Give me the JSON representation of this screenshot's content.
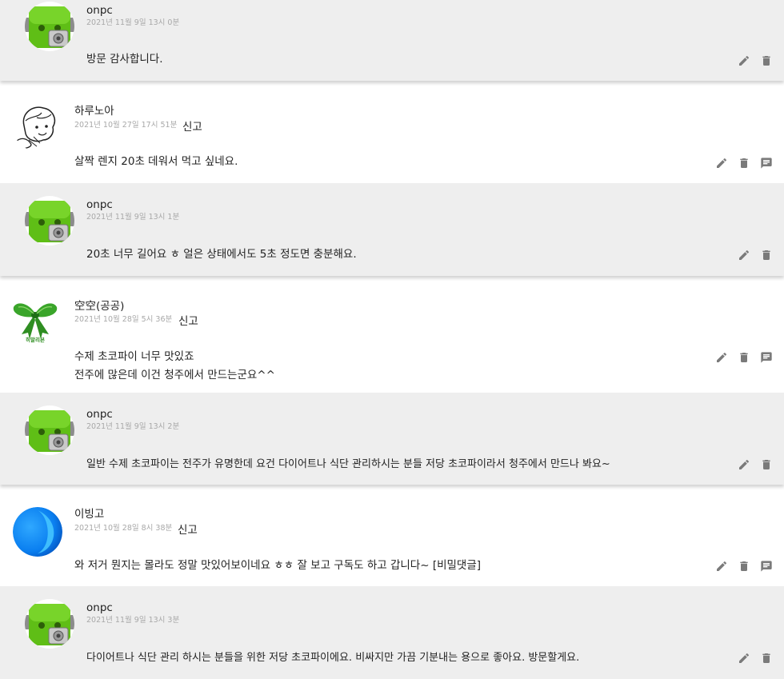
{
  "icons": {
    "edit": "pencil-icon",
    "delete": "trash-icon",
    "reply": "comment-icon"
  },
  "colors": {
    "reply_bg": "#eeeeee",
    "comment_bg": "#ffffff",
    "meta_text": "#a8a8a8",
    "action_icon": "#7a7a7a"
  },
  "threads": [
    {
      "reply": {
        "author": "onpc",
        "date": "2021년 11월 9일 13시 0분",
        "lines": [
          "방문 감사합니다."
        ]
      }
    },
    {
      "comment": {
        "author": "하루노아",
        "date": "2021년 10월 27일 17시 51분",
        "report": "신고",
        "lines": [
          "살짝 렌지 20초 데워서 먹고 싶네요."
        ]
      },
      "reply": {
        "author": "onpc",
        "date": "2021년 11월 9일 13시 1분",
        "lines": [
          "20초 너무 길어요 ㅎ 얼은 상태에서도 5초 정도면 충분해요."
        ]
      }
    },
    {
      "comment": {
        "author": "空空(공공)",
        "date": "2021년 10월 28일 5시 36분",
        "report": "신고",
        "avatar_caption": "히말리본",
        "lines": [
          "수제 초코파이 너무 맛있죠",
          "전주에 많은데 이건 청주에서 만드는군요^^"
        ]
      },
      "reply": {
        "author": "onpc",
        "date": "2021년 11월 9일 13시 2분",
        "lines": [
          "일반 수제 초코파이는 전주가 유명한데 요건 다이어트나 식단 관리하시는 분들 저당 초코파이라서 청주에서 만드나 봐요~"
        ]
      }
    },
    {
      "comment": {
        "author": "이빙고",
        "date": "2021년 10월 28일 8시 38분",
        "report": "신고",
        "lines": [
          "와 저거 뭔지는 몰라도 정말 맛있어보이네요 ㅎㅎ 잘 보고 구독도 하고 갑니다~ [비밀댓글]"
        ]
      },
      "reply": {
        "author": "onpc",
        "date": "2021년 11월 9일 13시 3분",
        "lines": [
          "다이어트나 식단 관리 하시는 분들을 위한 저당 초코파이에요. 비싸지만 가끔 기분내는 용으로 좋아요. 방문할게요."
        ]
      }
    }
  ]
}
